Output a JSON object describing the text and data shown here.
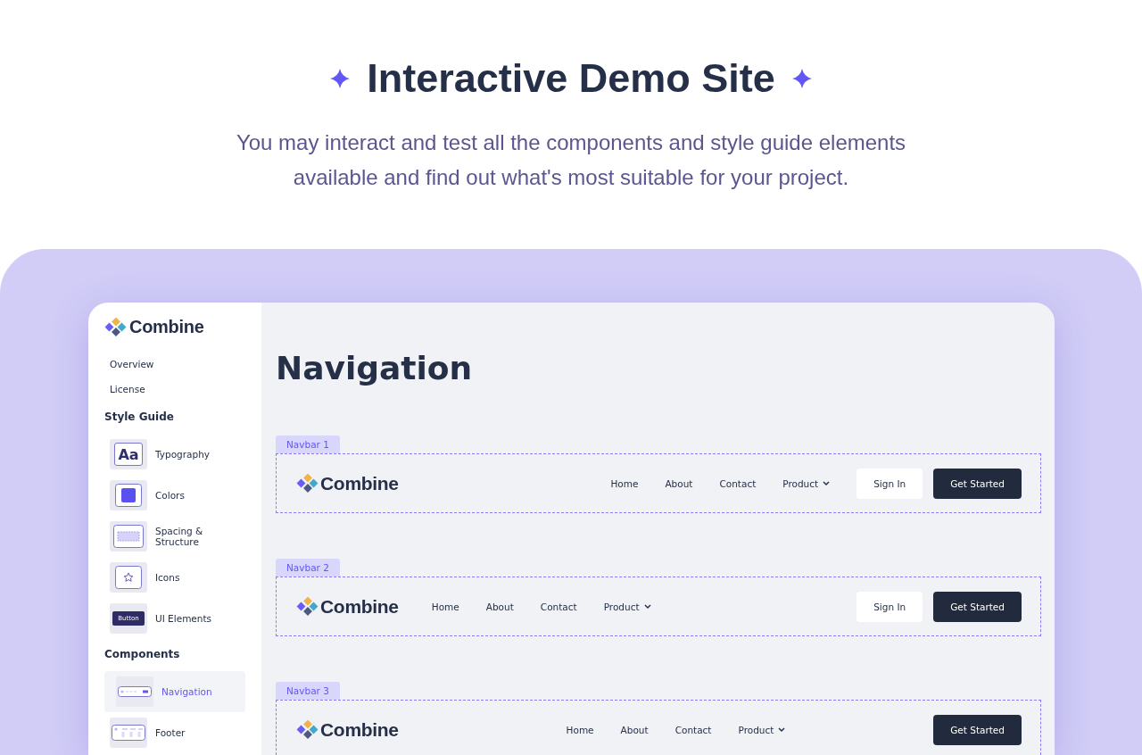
{
  "header": {
    "title": "Interactive Demo Site",
    "subtitle": "You may interact and test all the components and style guide elements available and find out what's most suitable for your project."
  },
  "sidebar": {
    "brand": "Combine",
    "links": [
      {
        "label": "Overview",
        "selected": false
      },
      {
        "label": "License",
        "selected": false
      }
    ],
    "sections": [
      {
        "title": "Style Guide",
        "items": [
          {
            "label": "Typography",
            "kind": "typography",
            "icon_text": "Aa",
            "selected": false
          },
          {
            "label": "Colors",
            "kind": "colors",
            "selected": false
          },
          {
            "label": "Spacing & Structure",
            "kind": "spacing",
            "selected": false
          },
          {
            "label": "Icons",
            "kind": "icons",
            "selected": false
          },
          {
            "label": "UI Elements",
            "kind": "ui-elements",
            "icon_text": "Button",
            "selected": false
          }
        ]
      },
      {
        "title": "Components",
        "items": [
          {
            "label": "Navigation",
            "kind": "navigation",
            "selected": true
          },
          {
            "label": "Footer",
            "kind": "footer",
            "selected": false
          }
        ]
      }
    ]
  },
  "main": {
    "title": "Navigation",
    "navbars": [
      {
        "label": "Navbar 1",
        "kind": "right",
        "brand": "Combine",
        "links": [
          "Home",
          "About",
          "Contact",
          "Product"
        ],
        "buttons": [
          {
            "label": "Sign In",
            "kind": "outline"
          },
          {
            "label": "Get Started",
            "kind": "solid"
          }
        ]
      },
      {
        "label": "Navbar 2",
        "kind": "left",
        "brand": "Combine",
        "links": [
          "Home",
          "About",
          "Contact",
          "Product"
        ],
        "buttons": [
          {
            "label": "Sign In",
            "kind": "outline"
          },
          {
            "label": "Get Started",
            "kind": "solid"
          }
        ]
      },
      {
        "label": "Navbar 3",
        "kind": "center",
        "brand": "Combine",
        "links": [
          "Home",
          "About",
          "Contact",
          "Product"
        ],
        "buttons": [
          {
            "label": "Get Started",
            "kind": "solid"
          }
        ]
      }
    ]
  }
}
